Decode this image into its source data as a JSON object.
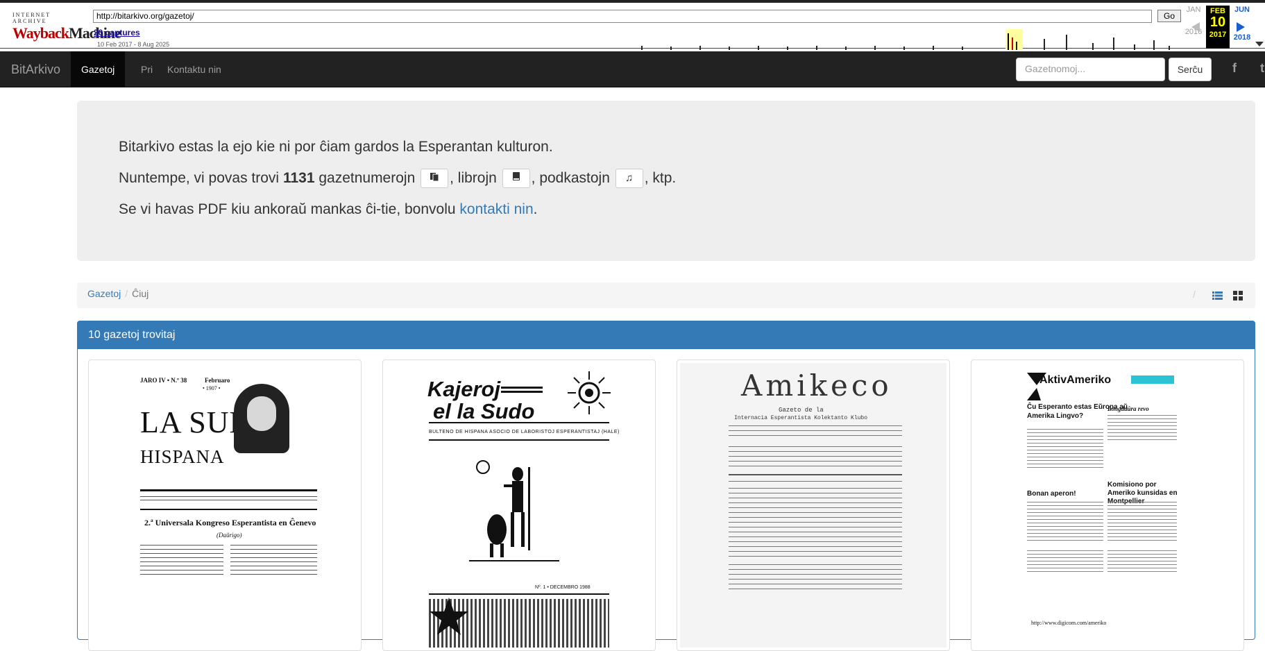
{
  "wayback": {
    "logo_top": "INTERNET ARCHIVE",
    "logo_wayback": "Wayback",
    "logo_machine": "Machine",
    "url": "http://bitarkivo.org/gazetoj/",
    "go_label": "Go",
    "captures": "20 captures",
    "date_range": "10 Feb 2017 - 8 Aug 2025",
    "prev": {
      "month": "JAN",
      "year": "2016"
    },
    "current": {
      "month": "FEB",
      "day": "10",
      "year": "2017"
    },
    "next": {
      "month": "JUN",
      "year": "2018"
    }
  },
  "navbar": {
    "brand": "BitArkivo",
    "items": [
      "Gazetoj",
      "Pri",
      "Kontaktu nin"
    ],
    "search_placeholder": "Gazetnomoj...",
    "search_button": "Serĉu",
    "facebook": "f",
    "twitter": "t"
  },
  "jumbo": {
    "line1": "Bitarkivo estas la ejo kie ni por ĉiam gardos la Esperantan kulturon.",
    "line2_a": "Nuntempe, vi povas trovi ",
    "line2_count": "1131",
    "line2_b": " gazetnumerojn",
    "line2_c": ", librojn",
    "line2_d": ", podkastojn",
    "line2_e": ", ktp.",
    "line3_a": "Se vi havas PDF kiu ankoraŭ mankas ĉi-tie, bonvolu ",
    "line3_link": "kontakti nin",
    "line3_b": "."
  },
  "breadcrumb": {
    "home": "Gazetoj",
    "separator": "/",
    "current": "Ĉiuj",
    "view_separator": "/"
  },
  "panel": {
    "title": "10 gazetoj trovitaj"
  },
  "thumbs": [
    {
      "header": "JARO IV • N.º 38",
      "month": "Februaro",
      "year": "• 1907 •",
      "title1": "LA SUNO",
      "title2": "HISPANA",
      "headline": "2.ª Universala Kongreso Esperantista en Ĝenevo",
      "sub": "(Daŭrigo)"
    },
    {
      "title1": "Kajeroj",
      "title2": "el la Sudo",
      "subtitle": "BULTENO DE HISPANA ASOCIO DE LABORISTOJ ESPERANTISTAJ (HALE)",
      "date": "Nº. 1 • DECEMBRO 1988"
    },
    {
      "title": "Amikeco",
      "sub1": "Gazeto de la",
      "sub2": "Internacia Esperantista Kolektanto Klubo"
    },
    {
      "title": "AktivAmeriko",
      "headline1": "Ĉu Esperanto estas Eŭropa aŭ Amerika Lingvo?",
      "headline2": "Longdaŭra revo",
      "headline3": "Bonan aperon!",
      "headline4": "Komisiono por Ameriko kunsidas en Montpellier",
      "url": "http://www.digicom.com/ameriko"
    }
  ]
}
